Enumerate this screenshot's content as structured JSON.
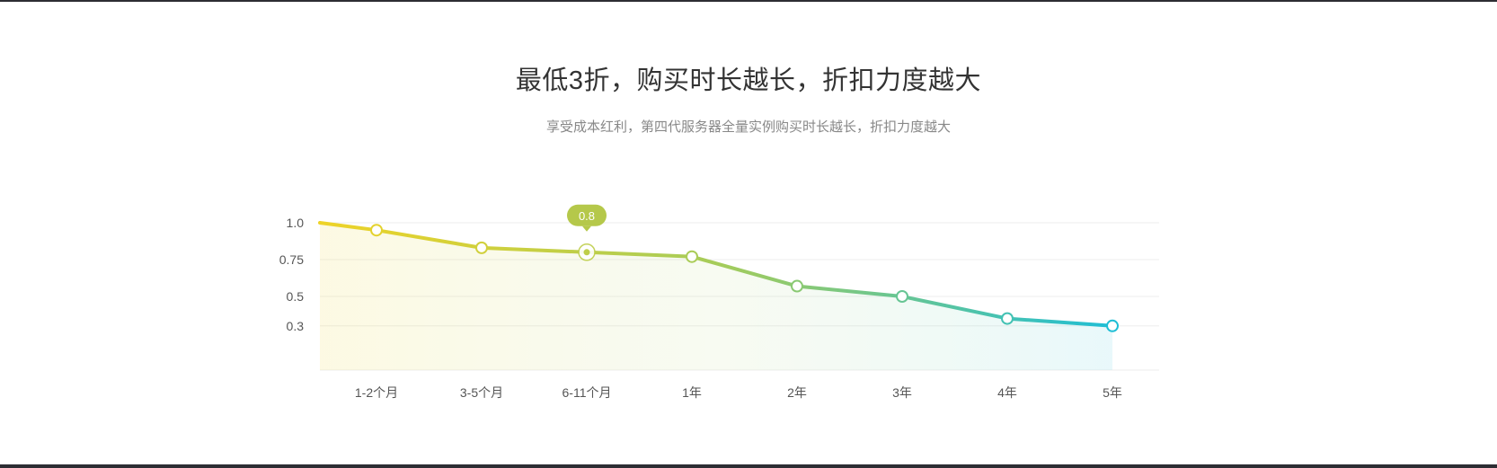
{
  "header": {
    "title": "最低3折，购买时长越长，折扣力度越大",
    "subtitle": "享受成本红利，第四代服务器全量实例购买时长越长，折扣力度越大"
  },
  "chart_data": {
    "type": "line",
    "categories": [
      "1-2个月",
      "3-5个月",
      "6-11个月",
      "1年",
      "2年",
      "3年",
      "4年",
      "5年"
    ],
    "values": [
      0.95,
      0.83,
      0.8,
      0.77,
      0.57,
      0.5,
      0.35,
      0.3
    ],
    "ylim": [
      0,
      1.0
    ],
    "yticks": [
      1.0,
      0.75,
      0.5,
      0.3
    ],
    "ytick_labels": [
      "1.0",
      "0.75",
      "0.5",
      "0.3"
    ],
    "grid": true,
    "area_fill": true,
    "tooltip": {
      "index": 2,
      "label": "0.8"
    },
    "colors": {
      "gradient_start": "#eed327",
      "gradient_mid": "#a6cc5a",
      "gradient_end": "#1fbed5",
      "tooltip_bg": "#b5c84a",
      "grid": "#eeeeee",
      "marker_fill": "#ffffff"
    }
  }
}
